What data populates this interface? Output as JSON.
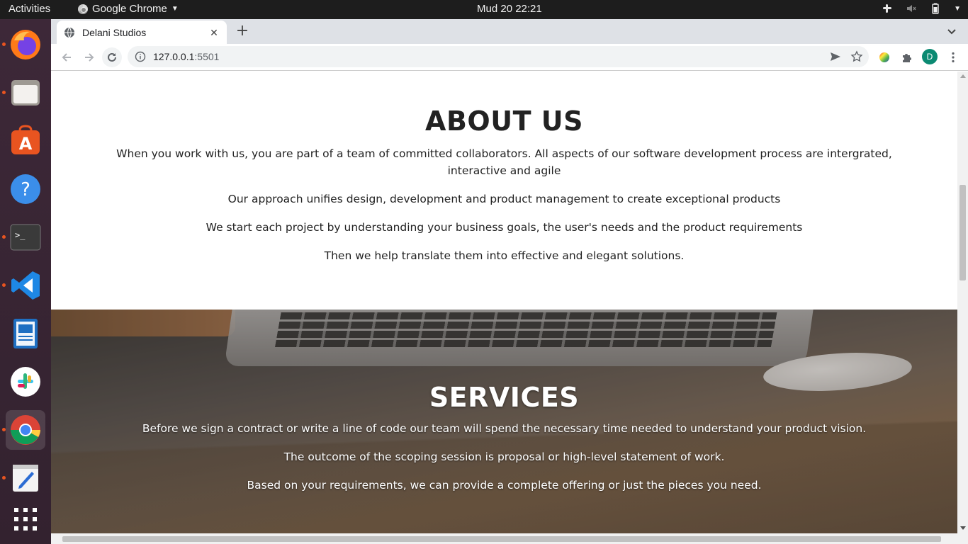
{
  "topbar": {
    "activities": "Activities",
    "app_name": "Google Chrome",
    "clock": "Mud 20  22:21"
  },
  "dock": {
    "items": [
      "firefox",
      "files",
      "software-center",
      "help",
      "terminal",
      "vscode",
      "document-viewer",
      "slack",
      "chrome",
      "text-editor",
      "app-grid"
    ]
  },
  "browser": {
    "tab_title": "Delani Studios",
    "url_host": "127.0.0.1",
    "url_port": ":5501",
    "profile_initial": "D"
  },
  "about": {
    "heading": "ABOUT US",
    "paragraphs": [
      "When you work with us, you are part of a team of committed collaborators. All aspects of our software development process are intergrated, interactive and agile",
      "Our approach unifies design, development and product management to create exceptional products",
      "We start each project by understanding your business goals, the user's needs and the product requirements",
      "Then we help translate them into effective and elegant solutions."
    ]
  },
  "services": {
    "heading": "SERVICES",
    "paragraphs": [
      "Before we sign a contract or write a line of code our team will spend the necessary time needed to understand your product vision.",
      "The outcome of the scoping session is proposal or high-level statement of work.",
      "Based on your requirements, we can provide a complete offering or just the pieces you need."
    ]
  },
  "colors": {
    "dock_indicator": "#e95420",
    "profile_avatar": "#0b8a72"
  }
}
